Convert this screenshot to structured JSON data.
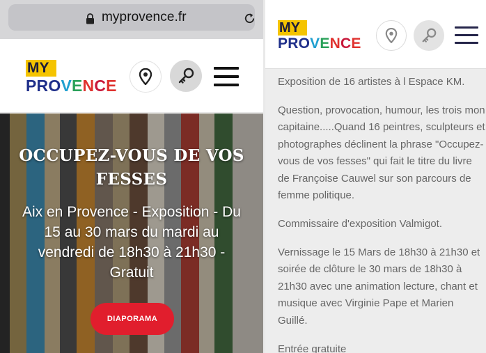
{
  "browser": {
    "url": "myprovence.fr"
  },
  "logo": {
    "my": "MY",
    "provence": [
      {
        "ch": "P",
        "color": "#1f2f8a"
      },
      {
        "ch": "R",
        "color": "#1f2f8a"
      },
      {
        "ch": "O",
        "color": "#1f2f8a"
      },
      {
        "ch": "V",
        "color": "#20a0d0"
      },
      {
        "ch": "E",
        "color": "#2aa15a"
      },
      {
        "ch": "N",
        "color": "#e0322f"
      },
      {
        "ch": "C",
        "color": "#c8183a"
      },
      {
        "ch": "E",
        "color": "#e0322f"
      }
    ]
  },
  "header": {
    "icons": [
      "location-pin-icon",
      "key-icon",
      "menu-icon"
    ]
  },
  "hero": {
    "title": "OCCUPEZ-VOUS DE VOS FESSES",
    "subtitle": "Aix en Provence - Exposition - Du 15 au 30 mars du mardi au vendredi de 18h30 à 21h30 - Gratuit",
    "button_label": "DIAPORAMA"
  },
  "article": {
    "paragraphs": [
      "Exposition de 16 artistes à l Espace KM.",
      "Question, provocation, humour, les trois mon capitaine.....Quand 16 peintres, sculpteurs et photographes déclinent la phrase \"Occupez-vous de vos fesses\" qui fait le titre du livre de Françoise Cauwel sur son parcours de femme politique.",
      "Commissaire d'exposition Valmigot.",
      "Vernissage le 15 Mars de 18h30 à 21h30 et soirée de clôture le 30 mars de 18h30 à 21h30 avec une animation lecture, chant et musique avec Virginie Pape et Marien Guillé.",
      "Entrée gratuite"
    ]
  },
  "colors": {
    "accent_red": "#e11e2d",
    "logo_yellow": "#f5c400",
    "logo_navy": "#1f2f8a"
  }
}
